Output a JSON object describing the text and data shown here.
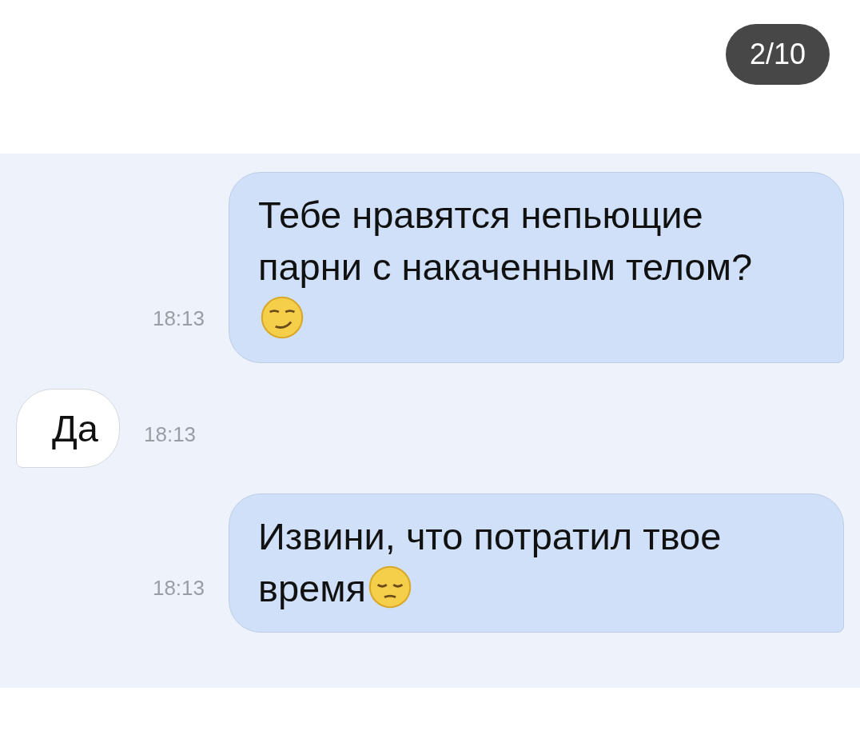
{
  "counter": "2/10",
  "messages": [
    {
      "kind": "outgoing",
      "text": "Тебе нравятся непьющие парни с накаченным телом?",
      "emoji": {
        "kind": "smirk"
      },
      "time": "18:13"
    },
    {
      "kind": "incoming",
      "text": "Да",
      "time": "18:13"
    },
    {
      "kind": "outgoing",
      "text": "Извини, что потратил твое время",
      "emoji": {
        "kind": "pensive"
      },
      "time": "18:13"
    }
  ]
}
